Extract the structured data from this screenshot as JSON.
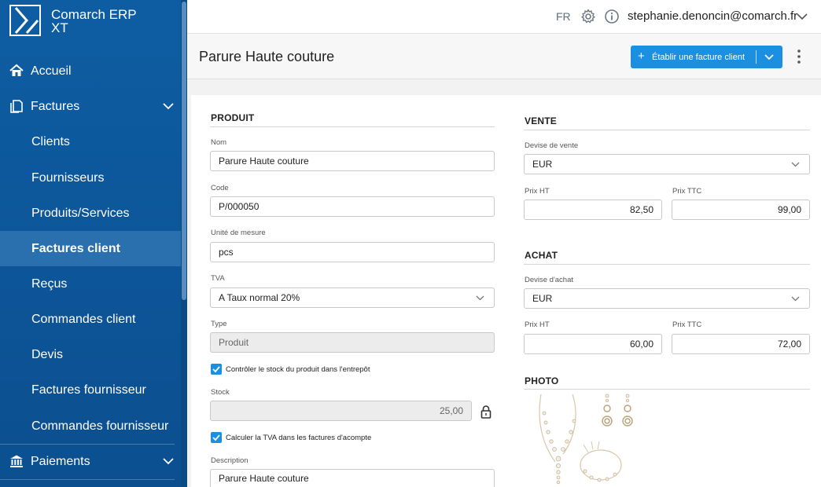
{
  "app": {
    "name_line1": "Comarch ERP",
    "name_line2": "XT"
  },
  "sidebar": {
    "items": [
      {
        "label": "Accueil",
        "icon": "home-icon"
      },
      {
        "label": "Factures",
        "icon": "document-icon"
      },
      {
        "label": "Clients"
      },
      {
        "label": "Fournisseurs"
      },
      {
        "label": "Produits/Services"
      },
      {
        "label": "Factures client"
      },
      {
        "label": "Reçus"
      },
      {
        "label": "Commandes client"
      },
      {
        "label": "Devis"
      },
      {
        "label": "Factures fournisseur"
      },
      {
        "label": "Commandes fournisseur"
      },
      {
        "label": "Paiements",
        "icon": "bank-icon"
      }
    ]
  },
  "topbar": {
    "lang": "FR",
    "user": "stephanie.denoncin@comarch.fr"
  },
  "header": {
    "title": "Parure Haute couture",
    "primary_action": "Établir une facture client",
    "plus": "+"
  },
  "produit": {
    "section": "PRODUIT",
    "nom_label": "Nom",
    "nom_value": "Parure Haute couture",
    "code_label": "Code",
    "code_value": "P/000050",
    "unite_label": "Unité de mesure",
    "unite_value": "pcs",
    "tva_label": "TVA",
    "tva_value": "A Taux normal 20%",
    "type_label": "Type",
    "type_value": "Produit",
    "check_stock_label": "Contrôler le stock du produit dans l'entrepôt",
    "stock_label": "Stock",
    "stock_value": "25,00",
    "check_tva_label": "Calculer la TVA dans les factures d'acompte",
    "description_label": "Description",
    "description_value": "Parure Haute couture"
  },
  "vente": {
    "section": "VENTE",
    "devise_label": "Devise de vente",
    "devise_value": "EUR",
    "prix_ht_label": "Prix HT",
    "prix_ht_value": "82,50",
    "prix_ttc_label": "Prix TTC",
    "prix_ttc_value": "99,00"
  },
  "achat": {
    "section": "ACHAT",
    "devise_label": "Devise d'achat",
    "devise_value": "EUR",
    "prix_ht_label": "Prix HT",
    "prix_ht_value": "60,00",
    "prix_ttc_label": "Prix TTC",
    "prix_ttc_value": "72,00"
  },
  "photo": {
    "section": "PHOTO"
  },
  "colors": {
    "sidebar": "#0e5da3",
    "active": "#2a6fae",
    "accent": "#1b8fe0"
  }
}
